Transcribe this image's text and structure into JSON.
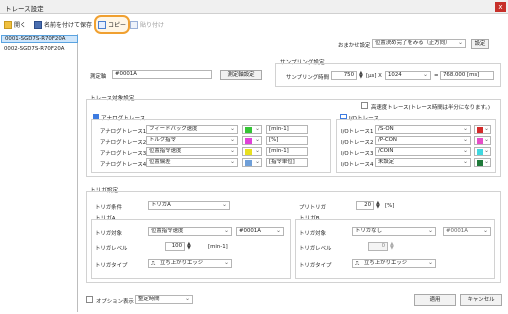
{
  "window": {
    "title": "トレース設定",
    "close": "x"
  },
  "toolbar": {
    "open": "開く",
    "save_as": "名前を付けて保存",
    "copy": "コピー",
    "paste": "貼り付け"
  },
  "axes": [
    "0001-SGD7S-R70F20A",
    "0002-SGD7S-R70F20A"
  ],
  "top": {
    "recommend_label": "おまかせ設定",
    "recommend_value": "位置決め完了をみる（正方向）",
    "set_button": "設定"
  },
  "measure": {
    "label": "測定軸",
    "value": "#0001A",
    "button": "測定軸設定"
  },
  "sampling": {
    "group": "サンプリング設定",
    "label": "サンプリング時間",
    "value": "750",
    "unit": "[μs] X",
    "count": "1024",
    "eq": "=",
    "result": "768.000 [ms]"
  },
  "trace_target": {
    "group": "トレース対象設定",
    "hs_label": "高速度トレース(トレース時間は半分になります。)",
    "analog_group": "アナログトレース",
    "io_group": "I/Oトレース",
    "analog": [
      {
        "label": "アナログトレース1",
        "signal": "フィードバック速度",
        "color": "#35c435",
        "unit": "[min-1]"
      },
      {
        "label": "アナログトレース2",
        "signal": "トルク指令",
        "color": "#e040d8",
        "unit": "[%]"
      },
      {
        "label": "アナログトレース3",
        "signal": "位置指令速度",
        "color": "#e8e020",
        "unit": "[min-1]"
      },
      {
        "label": "アナログトレース4",
        "signal": "位置偏差",
        "color": "#6f9fd8",
        "unit": "[指令単位]"
      }
    ],
    "io": [
      {
        "label": "I/Oトレース1",
        "signal": "/S-ON",
        "color": "#d42a2a"
      },
      {
        "label": "I/Oトレース2",
        "signal": "/P-CON",
        "color": "#e64ec8"
      },
      {
        "label": "I/Oトレース3",
        "signal": "/COIN",
        "color": "#40d8e0"
      },
      {
        "label": "I/Oトレース4",
        "signal": "未設定",
        "color": "#1f7a3a"
      }
    ]
  },
  "trigger": {
    "group": "トリガ設定",
    "cond_label": "トリガ条件",
    "cond_value": "トリガA",
    "pretrig_label": "プリトリガ",
    "pretrig_value": "20",
    "pretrig_unit": "[%]",
    "a": {
      "group": "トリガA",
      "target_label": "トリガ対象",
      "target_value": "位置指令速度",
      "axis_value": "#0001A",
      "level_label": "トリガレベル",
      "level_value": "100",
      "level_unit": "[min-1]",
      "type_label": "トリガタイプ",
      "type_value": "立ち上がりエッジ"
    },
    "b": {
      "group": "トリガB",
      "target_label": "トリガ対象",
      "target_value": "トリガなし",
      "axis_value": "#0001A",
      "level_label": "トリガレベル",
      "level_value": "0",
      "type_label": "トリガタイプ",
      "type_value": "立ち上がりエッジ"
    }
  },
  "bottom": {
    "option_label": "オプション表示",
    "option_value": "整定時間",
    "apply": "適用",
    "cancel": "キャンセル"
  }
}
